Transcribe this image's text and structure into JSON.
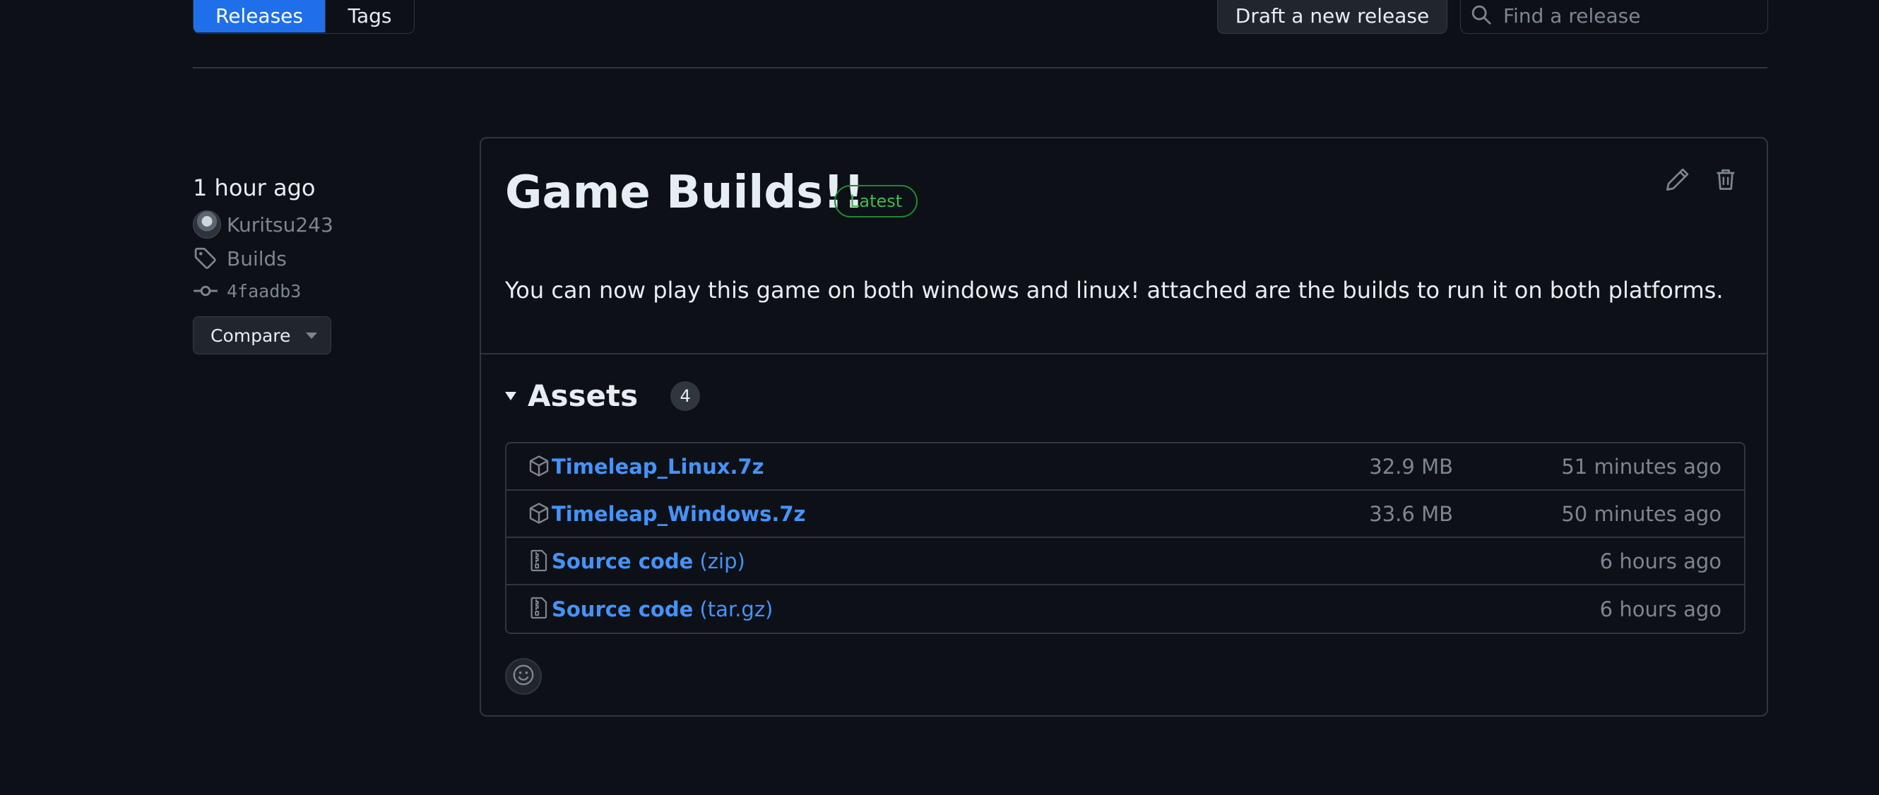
{
  "topbar": {
    "releases_tab": "Releases",
    "tags_tab": "Tags",
    "draft_button": "Draft a new release",
    "search_placeholder": "Find a release",
    "accent_color": "#1f6feb"
  },
  "meta": {
    "time": "1 hour ago",
    "author": "Kuritsu243",
    "tag": "Builds",
    "commit": "4faadb3",
    "compare_label": "Compare"
  },
  "release": {
    "title": "Game Builds!!",
    "badge": "Latest",
    "body": "You can now play this game on both windows and linux! attached are the builds to run it on both platforms."
  },
  "assets": {
    "title": "Assets",
    "count": "4",
    "items": [
      {
        "icon": "package-icon",
        "name": "Timeleap_Linux.7z",
        "suffix": "",
        "size": "32.9 MB",
        "time": "51 minutes ago"
      },
      {
        "icon": "package-icon",
        "name": "Timeleap_Windows.7z",
        "suffix": "",
        "size": "33.6 MB",
        "time": "50 minutes ago"
      },
      {
        "icon": "file-zip-icon",
        "name": "Source code",
        "suffix": " (zip)",
        "size": "",
        "time": "6 hours ago"
      },
      {
        "icon": "file-zip-icon",
        "name": "Source code",
        "suffix": " (tar.gz)",
        "size": "",
        "time": "6 hours ago"
      }
    ]
  }
}
